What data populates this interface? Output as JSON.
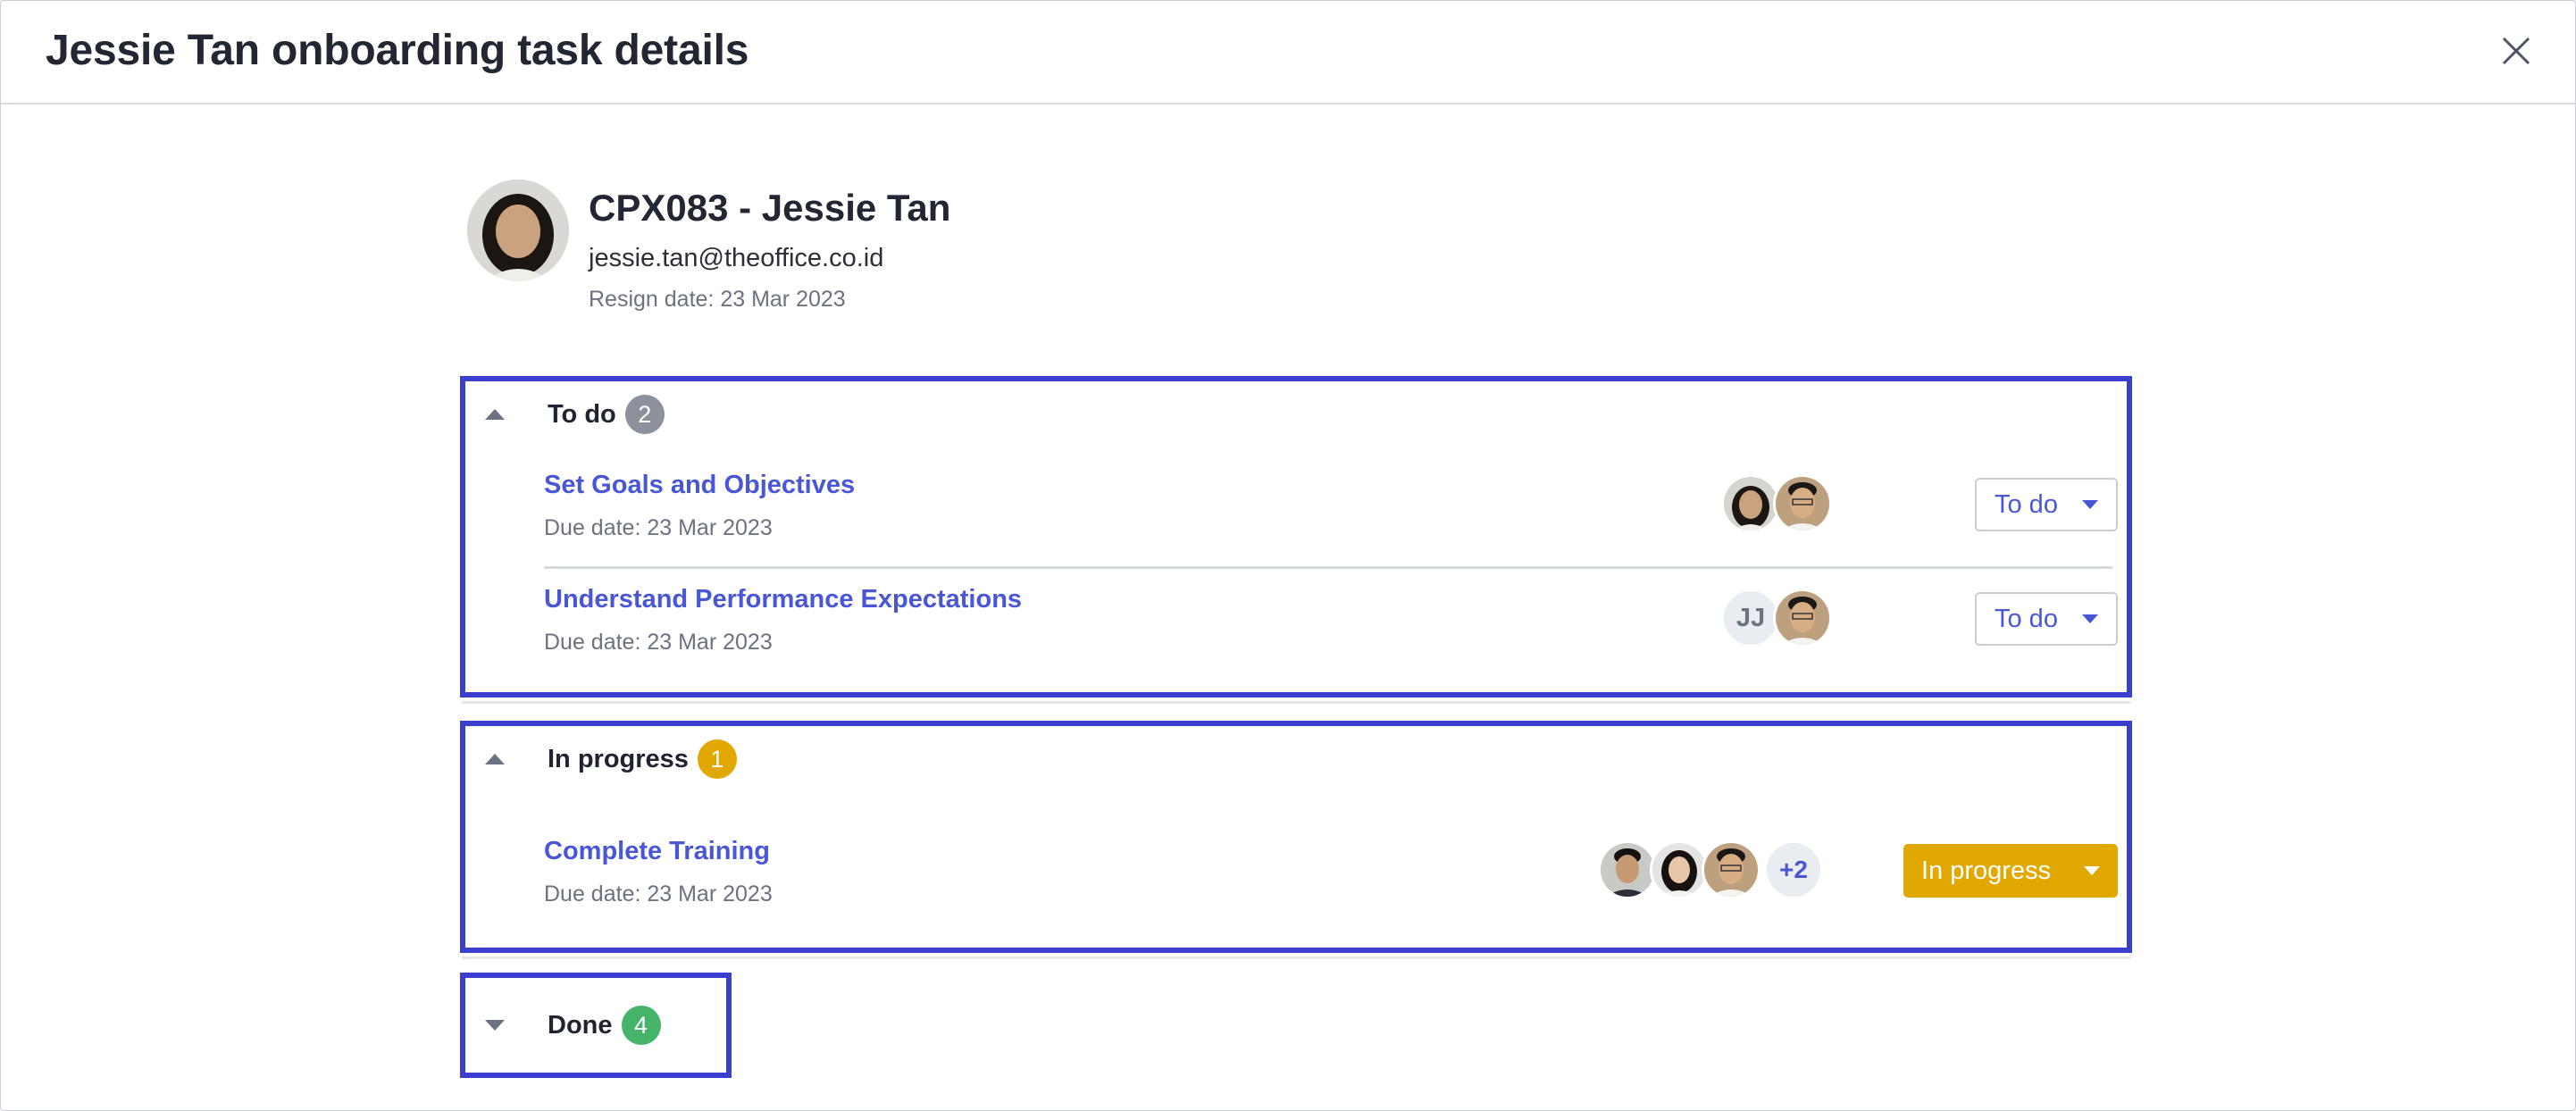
{
  "modal": {
    "title": "Jessie Tan onboarding task details"
  },
  "employee": {
    "name": "CPX083 - Jessie Tan",
    "email": "jessie.tan@theoffice.co.id",
    "resign_date": "Resign date: 23 Mar 2023"
  },
  "sections": {
    "todo": {
      "label": "To do",
      "count": "2",
      "expanded": true,
      "tasks": [
        {
          "title": "Set Goals and Objectives",
          "due": "Due date: 23 Mar 2023",
          "status": "To do"
        },
        {
          "title": "Understand Performance Expectations",
          "due": "Due date: 23 Mar 2023",
          "status": "To do",
          "assignee_initials": "JJ"
        }
      ]
    },
    "in_progress": {
      "label": "In progress",
      "count": "1",
      "expanded": true,
      "tasks": [
        {
          "title": "Complete Training",
          "due": "Due date: 23 Mar 2023",
          "status": "In progress",
          "more_assignees": "+2"
        }
      ]
    },
    "done": {
      "label": "Done",
      "count": "4",
      "expanded": false
    }
  },
  "colors": {
    "accent": "#4957d6",
    "highlight_border": "#3b3fcf",
    "in_progress": "#e0a800",
    "done": "#46b36a",
    "todo_badge": "#8c919c"
  },
  "icons": [
    "close-icon",
    "caret-up-icon",
    "caret-down-icon",
    "dropdown-arrow-icon",
    "user-avatar-photo"
  ]
}
